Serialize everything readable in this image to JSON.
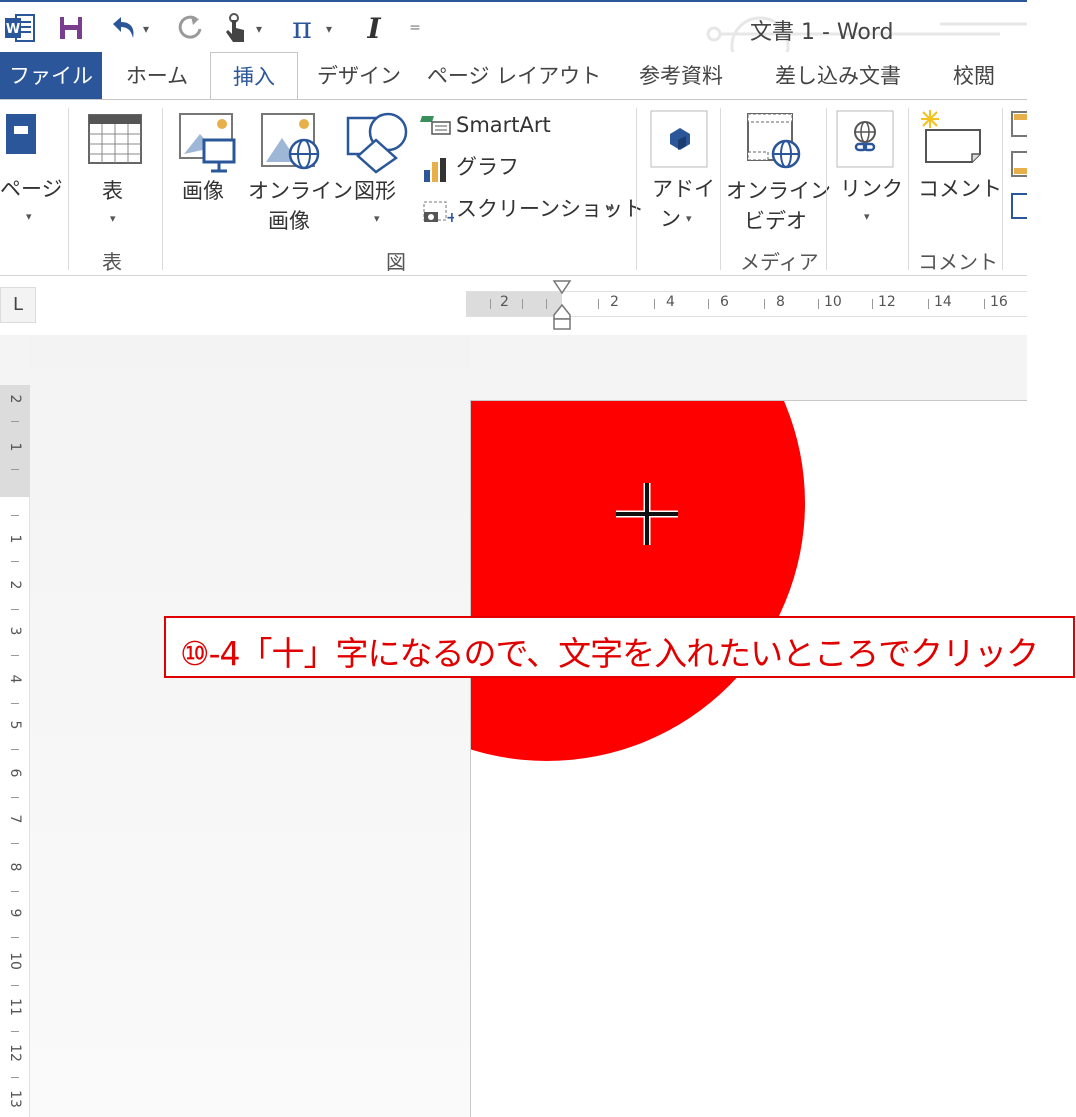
{
  "window": {
    "title": "文書 1 - Word"
  },
  "quick_access": {
    "items": [
      {
        "icon": "word-logo-icon"
      },
      {
        "icon": "save-icon"
      },
      {
        "icon": "undo-icon"
      },
      {
        "icon": "redo-icon"
      },
      {
        "icon": "touch-mode-icon"
      },
      {
        "icon": "equation-pi-icon",
        "glyph": "π"
      },
      {
        "icon": "italic-icon",
        "glyph": "I"
      },
      {
        "icon": "customize-qat-icon",
        "glyph": "="
      }
    ]
  },
  "tabs": [
    {
      "label": "ファイル",
      "type": "file"
    },
    {
      "label": "ホーム"
    },
    {
      "label": "挿入",
      "active": true
    },
    {
      "label": "デザイン"
    },
    {
      "label": "ページ レイアウト"
    },
    {
      "label": "参考資料"
    },
    {
      "label": "差し込み文書"
    },
    {
      "label": "校閲"
    }
  ],
  "ribbon": {
    "pages": {
      "label": "ページ"
    },
    "table": {
      "label": "表",
      "group": "表"
    },
    "illustrations": {
      "group": "図",
      "picture": "画像",
      "online_picture_line1": "オンライン",
      "online_picture_line2": "画像",
      "shapes": "図形",
      "smartart": "SmartArt",
      "chart": "グラフ",
      "screenshot": "スクリーンショット"
    },
    "addins": {
      "label_line1": "アドイ",
      "label_line2": "ン"
    },
    "media": {
      "group": "メディア",
      "online_video_line1": "オンライン",
      "online_video_line2": "ビデオ"
    },
    "links": {
      "label": "リンク"
    },
    "comments": {
      "group": "コメント",
      "comment": "コメント"
    }
  },
  "ruler": {
    "tab_selector": "L",
    "h_numbers": [
      "2",
      "2",
      "4",
      "6",
      "8",
      "10",
      "12",
      "14",
      "16"
    ],
    "v_numbers": [
      "2",
      "1",
      "1",
      "2",
      "3",
      "4",
      "5",
      "6",
      "7",
      "8",
      "9",
      "10",
      "11",
      "12",
      "13"
    ]
  },
  "shape": {
    "type": "circle",
    "color": "#ff0000",
    "cursor": "crosshair-icon"
  },
  "callout": {
    "text": "⑩-4「十」字になるので、文字を入れたいところでクリック",
    "color": "#e00000"
  },
  "colors": {
    "accent": "#2b579a"
  }
}
